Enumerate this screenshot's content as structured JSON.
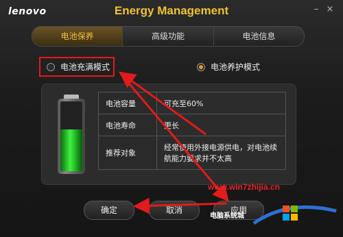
{
  "window": {
    "brand": "lenovo",
    "title": "Energy Management",
    "minimize_glyph": "–",
    "close_glyph": "×"
  },
  "tabs": [
    {
      "label": "电池保养",
      "active": true
    },
    {
      "label": "高级功能",
      "active": false
    },
    {
      "label": "电池信息",
      "active": false
    }
  ],
  "modes": {
    "full": {
      "label": "电池充满模式",
      "selected": false
    },
    "care": {
      "label": "电池养护模式",
      "selected": true
    }
  },
  "battery": {
    "level_fraction": 0.6,
    "fill_color": "#3ff23f"
  },
  "info_table": [
    {
      "key": "电池容量",
      "value": "可充至60%"
    },
    {
      "key": "电池寿命",
      "value": "更长"
    },
    {
      "key": "推荐对象",
      "value": "经常使用外接电源供电，对电池续航能力要求并不太高"
    }
  ],
  "buttons": {
    "ok": "确定",
    "cancel": "取消",
    "apply": "应用"
  },
  "watermark": {
    "url": "www.win7zhijia.cn",
    "site_text": "电脑系统城"
  },
  "colors": {
    "accent": "#f3c040",
    "annotation_red": "#e21b1b"
  }
}
